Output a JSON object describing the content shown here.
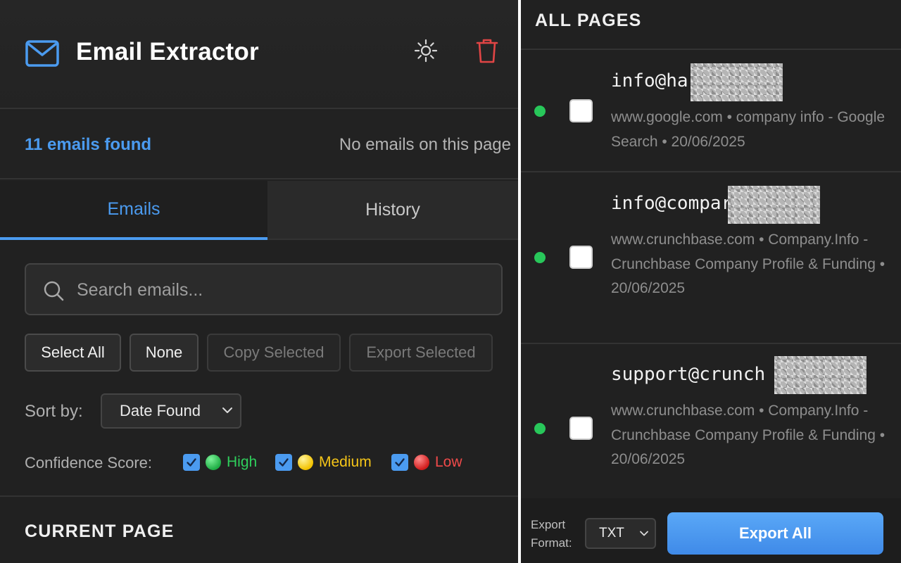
{
  "app": {
    "title": "Email Extractor"
  },
  "colors": {
    "accent": "#4b9bf0",
    "danger": "#e04545",
    "high": "#2fcf5c",
    "medium": "#f5c518",
    "low": "#f04a4a",
    "status": "#28c75a"
  },
  "icons": {
    "logo": "mail-icon",
    "theme": "sun-icon",
    "clear": "trash-icon",
    "search": "search-icon"
  },
  "stats": {
    "found": "11 emails found",
    "page_status": "No emails on this page"
  },
  "tabs": [
    {
      "label": "Emails",
      "active": true
    },
    {
      "label": "History",
      "active": false
    }
  ],
  "search": {
    "placeholder": "Search emails...",
    "value": ""
  },
  "actions": {
    "select_all": "Select All",
    "none": "None",
    "copy_selected": "Copy Selected",
    "export_selected": "Export Selected"
  },
  "sort": {
    "label": "Sort by:",
    "value": "Date Found"
  },
  "confidence": {
    "label": "Confidence Score:",
    "options": [
      {
        "label": "High",
        "checked": true
      },
      {
        "label": "Medium",
        "checked": true
      },
      {
        "label": "Low",
        "checked": true
      }
    ]
  },
  "sections": {
    "current_page": "CURRENT PAGE",
    "all_pages": "ALL PAGES"
  },
  "entries": [
    {
      "email": "info@ha",
      "meta": "www.google.com • company info - Google Search • 20/06/2025",
      "checked": false
    },
    {
      "email": "info@compar",
      "meta": "www.crunchbase.com • Company.Info - Crunchbase Company Profile & Funding • 20/06/2025",
      "checked": false
    },
    {
      "email": "support@crunch",
      "meta": "www.crunchbase.com • Company.Info - Crunchbase Company Profile & Funding • 20/06/2025",
      "checked": false
    }
  ],
  "footer": {
    "format_label": "Export Format:",
    "format_value": "TXT",
    "export_all": "Export All"
  }
}
